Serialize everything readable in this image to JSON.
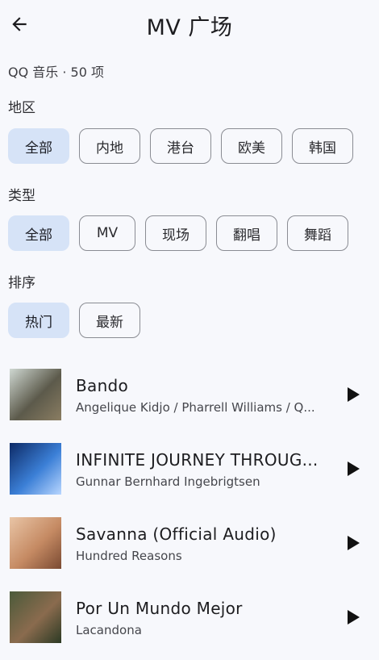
{
  "header": {
    "title": "MV 广场"
  },
  "subtitle": "QQ 音乐 · 50 项",
  "filters": {
    "region": {
      "label": "地区",
      "chips": [
        {
          "label": "全部",
          "selected": true
        },
        {
          "label": "内地",
          "selected": false
        },
        {
          "label": "港台",
          "selected": false
        },
        {
          "label": "欧美",
          "selected": false
        },
        {
          "label": "韩国",
          "selected": false
        }
      ]
    },
    "type": {
      "label": "类型",
      "chips": [
        {
          "label": "全部",
          "selected": true
        },
        {
          "label": "MV",
          "selected": false
        },
        {
          "label": "现场",
          "selected": false
        },
        {
          "label": "翻唱",
          "selected": false
        },
        {
          "label": "舞蹈",
          "selected": false
        }
      ]
    },
    "sort": {
      "label": "排序",
      "chips": [
        {
          "label": "热门",
          "selected": true
        },
        {
          "label": "最新",
          "selected": false
        }
      ]
    }
  },
  "mvs": [
    {
      "title": "Bando",
      "artist": "Angelique Kidjo / Pharrell Williams / Q...",
      "thumb_colors": [
        "#cfd8d2",
        "#5c5a4b",
        "#8a7d62"
      ]
    },
    {
      "title": "INFINITE JOURNEY THROUG...",
      "artist": "Gunnar Bernhard Ingebrigtsen",
      "thumb_colors": [
        "#0d2a66",
        "#3b7fd6",
        "#b8d6ff"
      ]
    },
    {
      "title": "Savanna (Official Audio)",
      "artist": "Hundred Reasons",
      "thumb_colors": [
        "#e9c5a6",
        "#c58a63",
        "#7a4a32"
      ]
    },
    {
      "title": "Por Un Mundo Mejor",
      "artist": "Lacandona",
      "thumb_colors": [
        "#4b5a3a",
        "#8a6b4e",
        "#2c3a24"
      ]
    }
  ]
}
